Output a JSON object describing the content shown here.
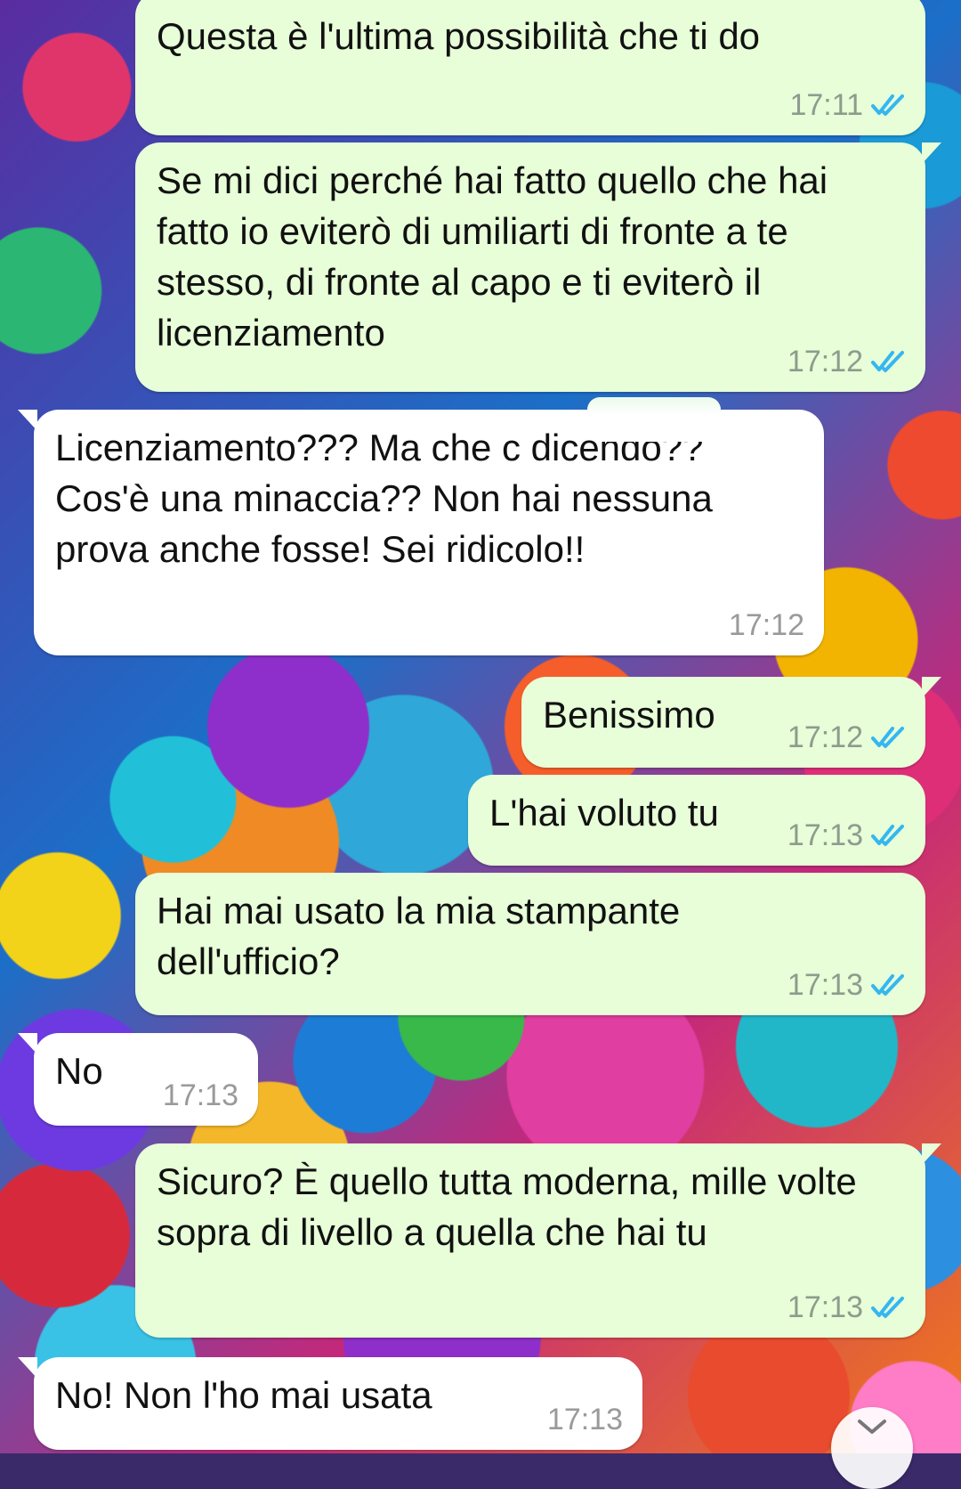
{
  "colors": {
    "outgoing_bubble": "#e7fed8",
    "incoming_bubble": "#ffffff",
    "read_ticks": "#34b7f1",
    "time_text": "#8d9c8d"
  },
  "messages": [
    {
      "direction": "outgoing",
      "text": "Questa è l'ultima possibilità che ti do",
      "time": "17:11",
      "status": "read"
    },
    {
      "direction": "outgoing",
      "text": "Se mi dici perché hai fatto quello che hai fatto io eviterò di umiliarti di fronte a te stesso, di fronte al capo e ti eviterò il licenziamento",
      "time": "17:12",
      "status": "read"
    },
    {
      "direction": "incoming",
      "text": "Licenziamento??? Ma che c dicendo?? Cos'è una minaccia?? Non hai nessuna prova anche fosse! Sei ridicolo!!",
      "time": "17:12"
    },
    {
      "direction": "outgoing",
      "text": "Benissimo",
      "time": "17:12",
      "status": "read"
    },
    {
      "direction": "outgoing",
      "text": "L'hai voluto tu",
      "time": "17:13",
      "status": "read"
    },
    {
      "direction": "outgoing",
      "text": "Hai mai usato la mia stampante dell'ufficio?",
      "time": "17:13",
      "status": "read"
    },
    {
      "direction": "incoming",
      "text": "No",
      "time": "17:13"
    },
    {
      "direction": "outgoing",
      "text": "Sicuro? È quello tutta moderna, mille volte sopra di livello a quella che hai tu",
      "time": "17:13",
      "status": "read"
    },
    {
      "direction": "incoming",
      "text": "No! Non l'ho mai usata",
      "time": "17:13"
    }
  ],
  "scroll_button_icon": "chevron-down-icon"
}
